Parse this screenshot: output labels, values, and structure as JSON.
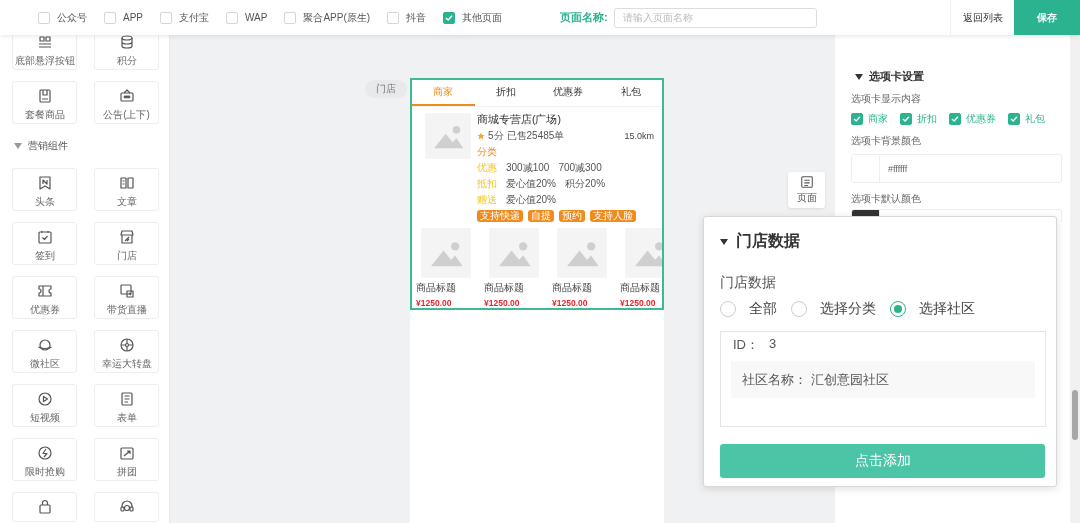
{
  "top_bar": {
    "channels": [
      {
        "label": "公众号",
        "checked": false
      },
      {
        "label": "APP",
        "checked": false
      },
      {
        "label": "支付宝",
        "checked": false
      },
      {
        "label": "WAP",
        "checked": false
      },
      {
        "label": "聚合APP(原生)",
        "checked": false
      },
      {
        "label": "抖音",
        "checked": false
      },
      {
        "label": "其他页面",
        "checked": true
      }
    ],
    "page_name": {
      "label": "页面名称:",
      "placeholder": "请输入页面名称"
    },
    "back_button": "返回列表",
    "save_button": "保存"
  },
  "sidebar": {
    "groups": [
      {
        "items": [
          {
            "label": "底部悬浮按钮"
          },
          {
            "label": "积分"
          },
          {
            "label": "套餐商品"
          },
          {
            "label": "公告(上下)"
          }
        ]
      },
      {
        "title": "营销组件",
        "expanded": true,
        "items": [
          {
            "label": "头条"
          },
          {
            "label": "文章"
          },
          {
            "label": "签到"
          },
          {
            "label": "门店"
          },
          {
            "label": "优惠券"
          },
          {
            "label": "带货直播"
          },
          {
            "label": "微社区"
          },
          {
            "label": "幸运大转盘"
          },
          {
            "label": "短视频"
          },
          {
            "label": "表单"
          },
          {
            "label": "限时抢购"
          },
          {
            "label": "拼团"
          },
          {
            "kind": "cut"
          },
          {
            "kind": "cut"
          }
        ]
      }
    ]
  },
  "canvas": {
    "component_tag": "门店",
    "page_tool": "页面"
  },
  "preview": {
    "tabs": [
      {
        "label": "商家",
        "selected": true
      },
      {
        "label": "折扣",
        "selected": false
      },
      {
        "label": "优惠券",
        "selected": false
      },
      {
        "label": "礼包",
        "selected": false
      }
    ],
    "store": {
      "name": "商城专营店(广场)",
      "rating": "5分",
      "sold": "已售25485单",
      "distance": "15.0km",
      "category": "分类",
      "promos": [
        {
          "label": "优惠",
          "texts": [
            "300减100",
            "700减300"
          ]
        },
        {
          "label": "抵扣",
          "texts": [
            "爱心值20%",
            "积分20%"
          ]
        },
        {
          "label": "赠送",
          "texts": [
            "爱心值20%"
          ]
        }
      ],
      "tags": [
        "支持快递",
        "自提",
        "预约",
        "支持人脸"
      ]
    },
    "products": [
      {
        "title": "商品标题",
        "price": "¥1250.00"
      },
      {
        "title": "商品标题",
        "price": "¥1250.00"
      },
      {
        "title": "商品标题",
        "price": "¥1250.00"
      },
      {
        "title": "商品标题",
        "price": "¥1250.00"
      }
    ]
  },
  "settings": {
    "section": "选项卡设置",
    "expanded": true,
    "tab_content": {
      "label": "选项卡显示内容",
      "options": [
        {
          "label": "商家",
          "checked": true
        },
        {
          "label": "折扣",
          "checked": true
        },
        {
          "label": "优惠券",
          "checked": true
        },
        {
          "label": "礼包",
          "checked": true
        }
      ]
    },
    "bg_color": {
      "label": "选项卡背景颜色",
      "value": "#ffffff"
    },
    "default_color": {
      "label": "选项卡默认颜色",
      "color": "#333333"
    }
  },
  "popup": {
    "title": "门店数据",
    "expanded": true,
    "field_label": "门店数据",
    "options": [
      {
        "label": "全部",
        "selected": false
      },
      {
        "label": "选择分类",
        "selected": false
      },
      {
        "label": "选择社区",
        "selected": true
      }
    ],
    "entry": {
      "id_label": "ID：",
      "id": "3",
      "name_label": "社区名称：",
      "name": "汇创意园社区"
    },
    "add_button": "点击添加"
  }
}
